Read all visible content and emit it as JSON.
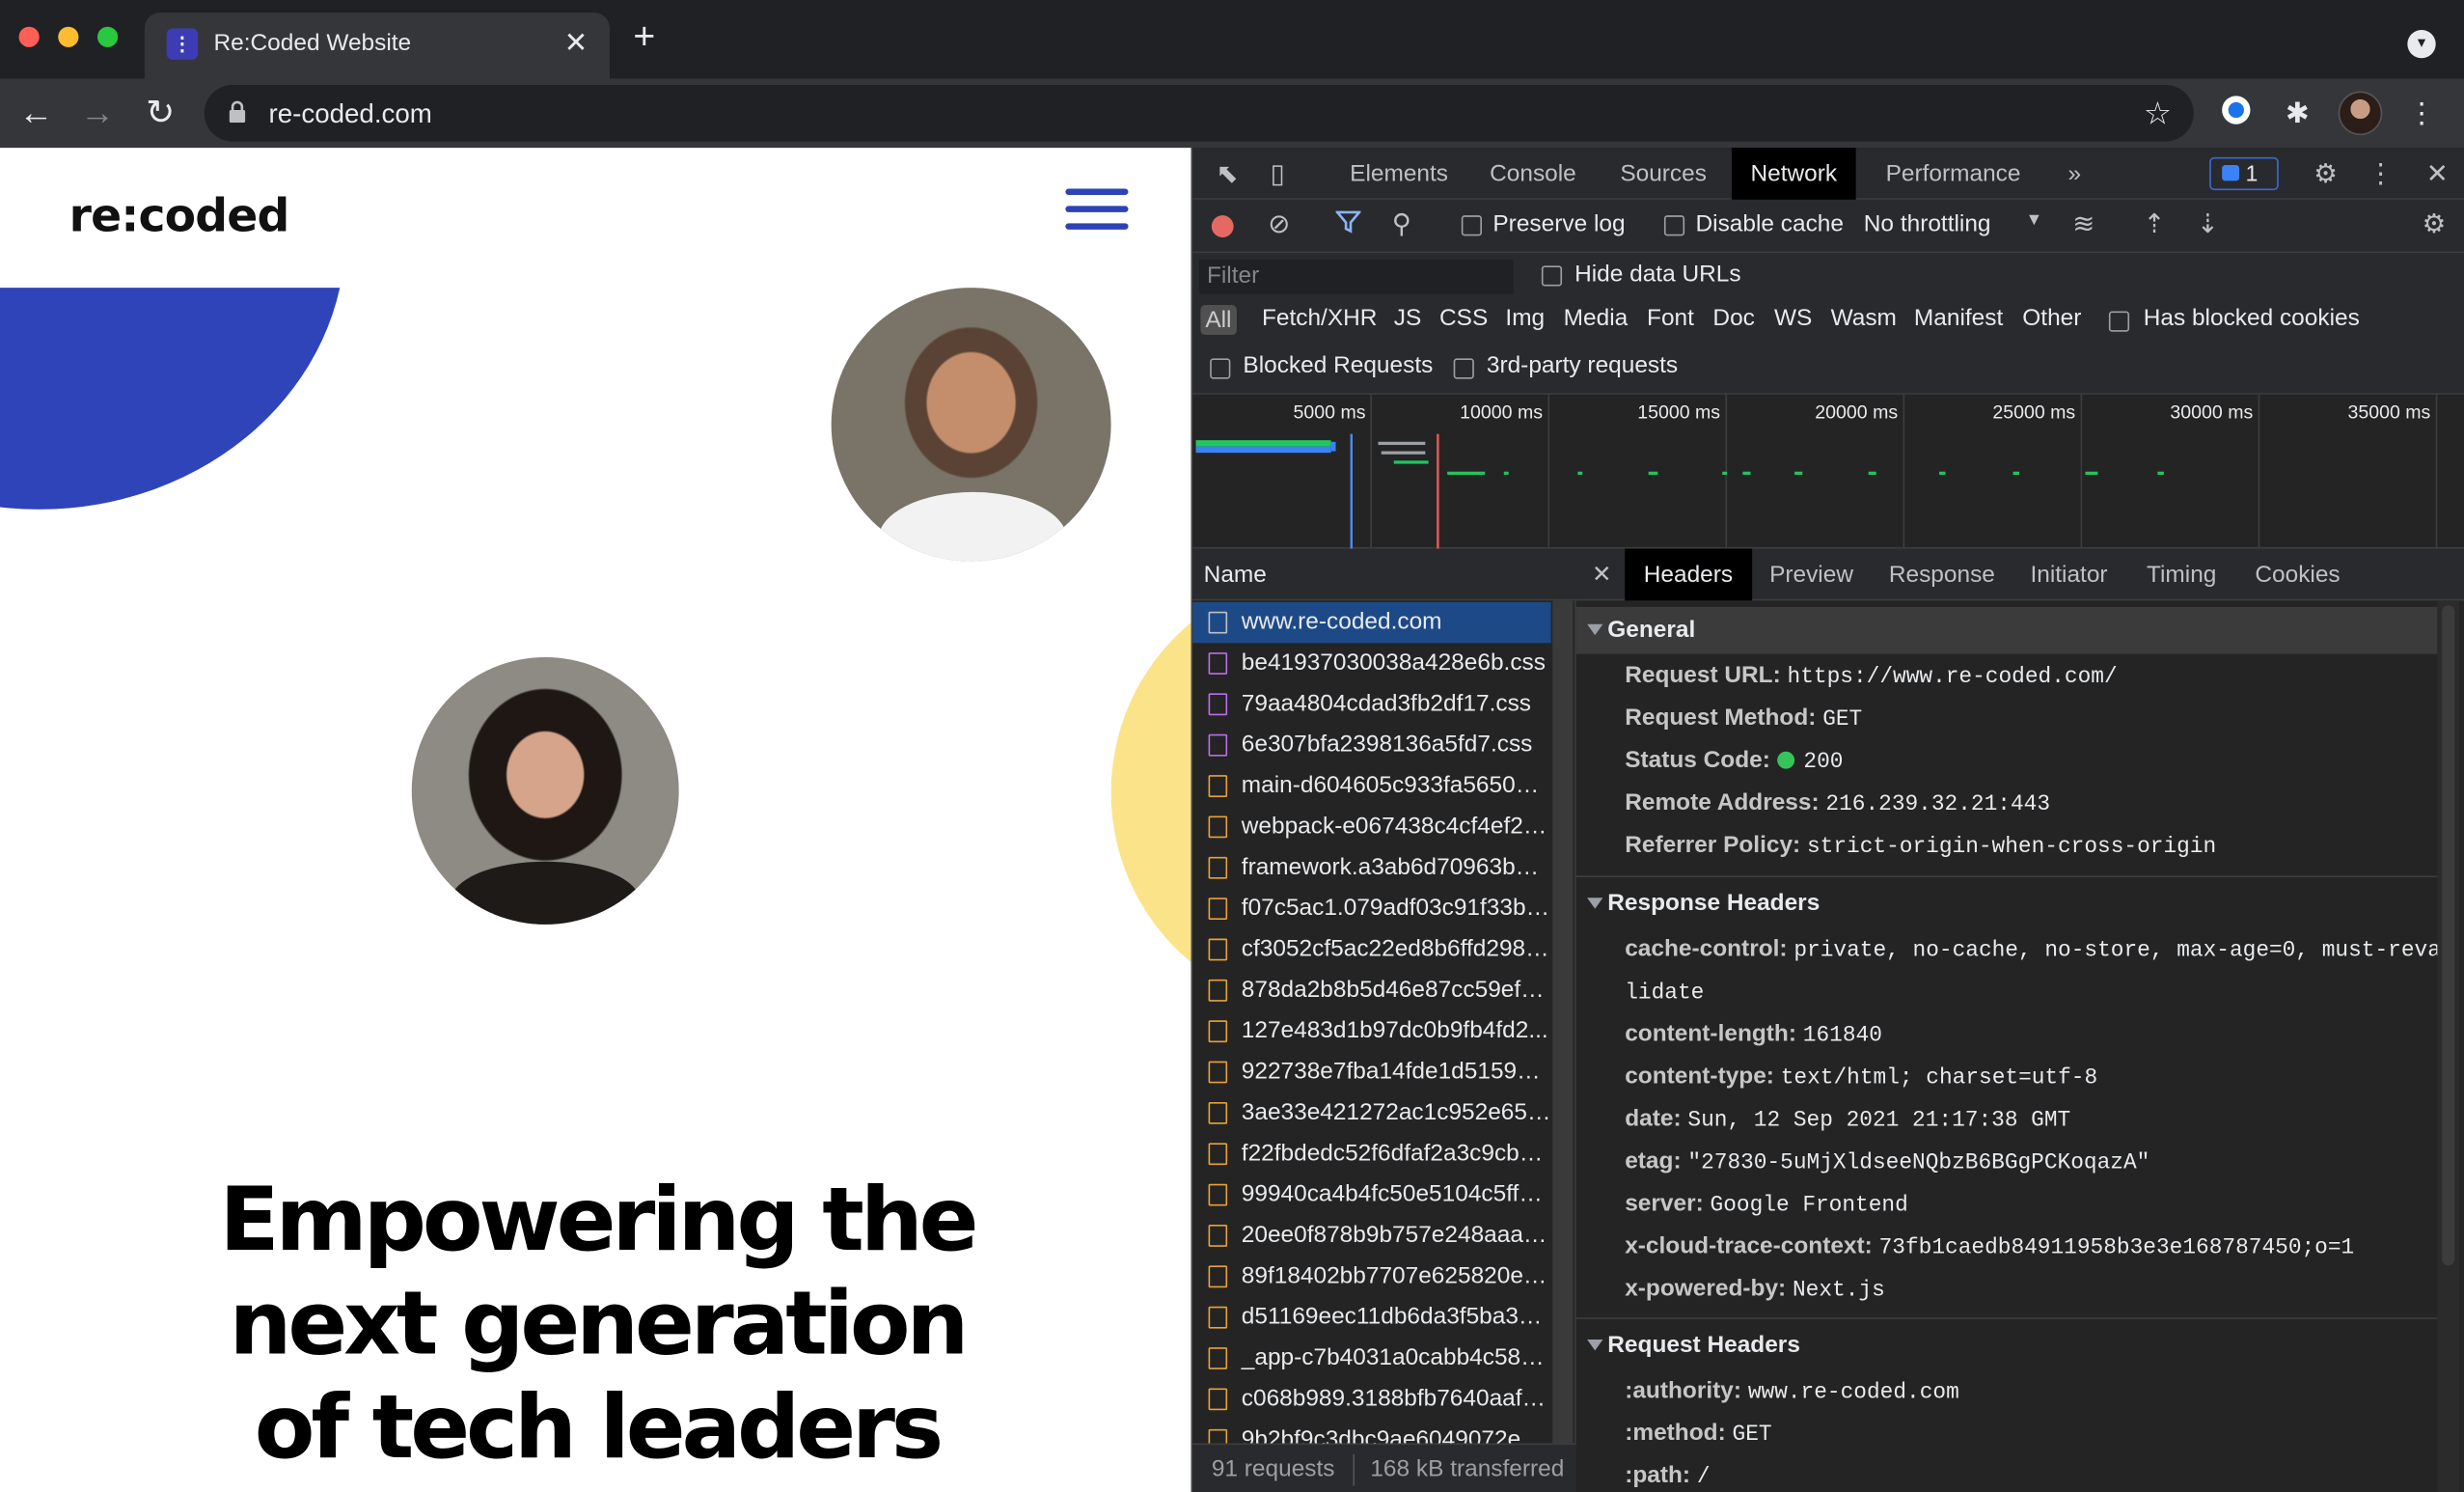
{
  "browser": {
    "tab_title": "Re:Coded Website",
    "url": "re-coded.com",
    "new_tab": "+",
    "tab_close": "✕"
  },
  "page": {
    "logo": "re:coded",
    "hero_lines": [
      "Empowering the",
      "next generation",
      "of tech leaders"
    ]
  },
  "devtools": {
    "tabs": [
      "Elements",
      "Console",
      "Sources",
      "Network",
      "Performance"
    ],
    "active_tab": "Network",
    "more": "»",
    "issues_count": "1",
    "toolbar": {
      "preserve_log": "Preserve log",
      "disable_cache": "Disable cache",
      "throttling": "No throttling"
    },
    "filter": {
      "placeholder": "Filter",
      "hide_data_urls": "Hide data URLs",
      "types": [
        "All",
        "Fetch/XHR",
        "JS",
        "CSS",
        "Img",
        "Media",
        "Font",
        "Doc",
        "WS",
        "Wasm",
        "Manifest",
        "Other"
      ],
      "has_blocked_cookies": "Has blocked cookies",
      "blocked_requests": "Blocked Requests",
      "third_party": "3rd-party requests"
    },
    "timeline_labels": [
      "5000 ms",
      "10000 ms",
      "15000 ms",
      "20000 ms",
      "25000 ms",
      "30000 ms",
      "35000 ms"
    ],
    "requests_header": "Name",
    "requests": [
      {
        "name": "www.re-coded.com",
        "type": "doc"
      },
      {
        "name": "be41937030038a428e6b.css",
        "type": "css"
      },
      {
        "name": "79aa4804cdad3fb2df17.css",
        "type": "css"
      },
      {
        "name": "6e307bfa2398136a5fd7.css",
        "type": "css"
      },
      {
        "name": "main-d604605c933fa565028...",
        "type": "js"
      },
      {
        "name": "webpack-e067438c4cf4ef2e...",
        "type": "js"
      },
      {
        "name": "framework.a3ab6d70963b92...",
        "type": "js"
      },
      {
        "name": "f07c5ac1.079adf03c91f33b7...",
        "type": "js"
      },
      {
        "name": "cf3052cf5ac22ed8b6ffd2986...",
        "type": "js"
      },
      {
        "name": "878da2b8b5d46e87cc59ef7...",
        "type": "js"
      },
      {
        "name": "127e483d1b97dc0b9fb4fd2...",
        "type": "js"
      },
      {
        "name": "922738e7fba14fde1d515988...",
        "type": "js"
      },
      {
        "name": "3ae33e421272ac1c952e654...",
        "type": "js"
      },
      {
        "name": "f22fbdedc52f6dfaf2a3c9cb4...",
        "type": "js"
      },
      {
        "name": "99940ca4b4fc50e5104c5ff1...",
        "type": "js"
      },
      {
        "name": "20ee0f878b9b757e248aaab...",
        "type": "js"
      },
      {
        "name": "89f18402bb7707e625820e5...",
        "type": "js"
      },
      {
        "name": "d51169eec11db6da3f5ba37...",
        "type": "js"
      },
      {
        "name": "_app-c7b4031a0cabb4c58d...",
        "type": "js"
      },
      {
        "name": "c068b989.3188bfb7640aaf9...",
        "type": "js"
      },
      {
        "name": "9b2bf9c3dbc9ae6049072e0...",
        "type": "js"
      }
    ],
    "status": {
      "requests": "91 requests",
      "transferred": "168 kB transferred"
    },
    "detail_tabs": [
      "Headers",
      "Preview",
      "Response",
      "Initiator",
      "Timing",
      "Cookies"
    ],
    "general": {
      "title": "General",
      "rows": [
        {
          "k": "Request URL:",
          "v": "https://www.re-coded.com/"
        },
        {
          "k": "Request Method:",
          "v": "GET"
        },
        {
          "k": "Status Code:",
          "v": "200"
        },
        {
          "k": "Remote Address:",
          "v": "216.239.32.21:443"
        },
        {
          "k": "Referrer Policy:",
          "v": "strict-origin-when-cross-origin"
        }
      ]
    },
    "response_headers": {
      "title": "Response Headers",
      "cache_control_k": "cache-control:",
      "cache_control_v1": "private, no-cache, no-store, max-age=0, must-reva",
      "cache_control_v2": "lidate",
      "rows": [
        {
          "k": "content-length:",
          "v": "161840"
        },
        {
          "k": "content-type:",
          "v": "text/html; charset=utf-8"
        },
        {
          "k": "date:",
          "v": "Sun, 12 Sep 2021 21:17:38 GMT"
        },
        {
          "k": "etag:",
          "v": "\"27830-5uMjXldseeNQbzB6BGgPCKoqazA\""
        },
        {
          "k": "server:",
          "v": "Google Frontend"
        },
        {
          "k": "x-cloud-trace-context:",
          "v": "73fb1caedb84911958b3e3e168787450;o=1"
        },
        {
          "k": "x-powered-by:",
          "v": "Next.js"
        }
      ]
    },
    "request_headers": {
      "title": "Request Headers",
      "rows": [
        {
          "k": ":authority:",
          "v": "www.re-coded.com"
        },
        {
          "k": ":method:",
          "v": "GET"
        },
        {
          "k": ":path:",
          "v": "/"
        }
      ]
    }
  }
}
